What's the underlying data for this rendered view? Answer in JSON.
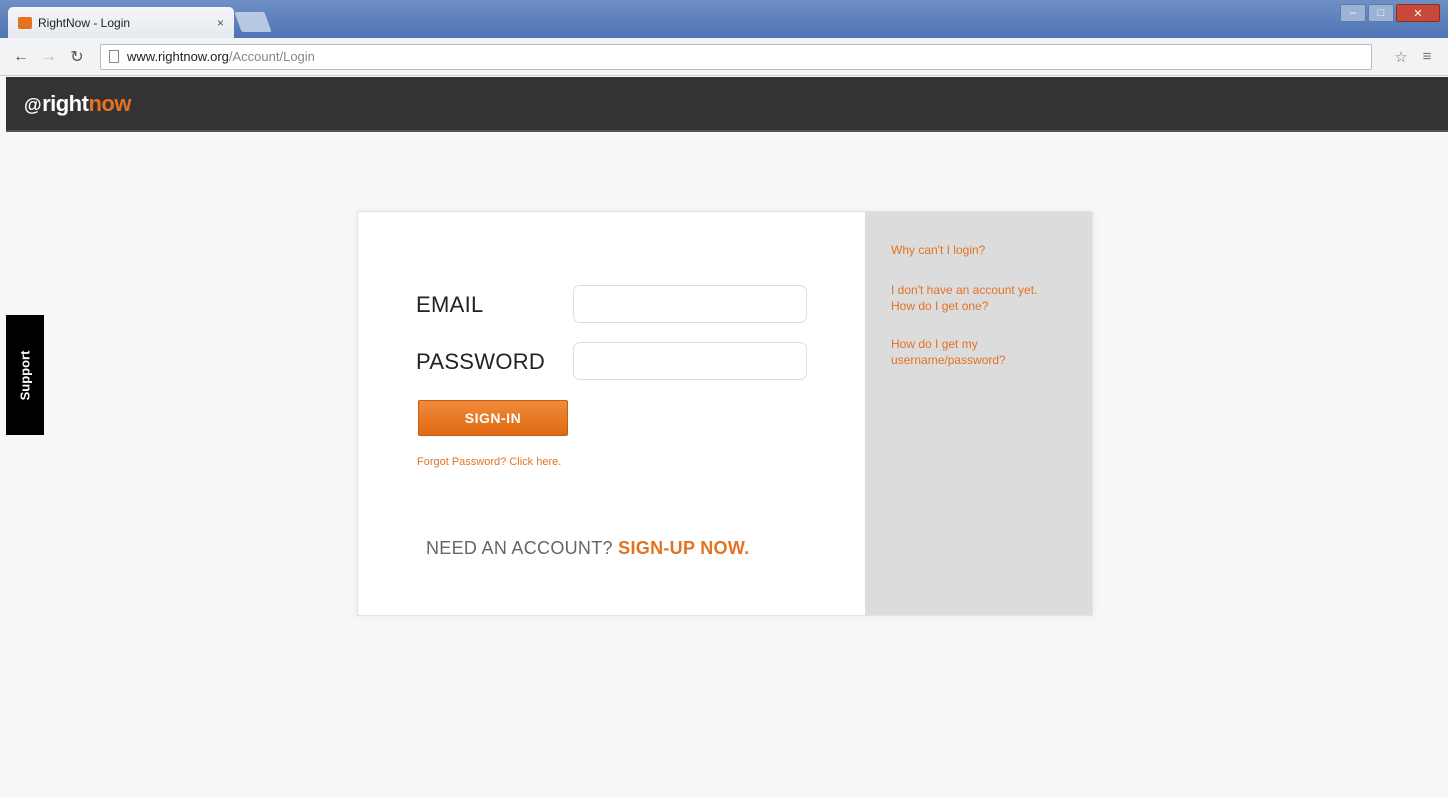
{
  "browser": {
    "tab_title": "RightNow - Login",
    "tab_close": "×",
    "url_host": "www.rightnow.org",
    "url_path": "/Account/Login"
  },
  "site": {
    "logo_prefix": "@",
    "logo_right": "right",
    "logo_now": "now"
  },
  "support": {
    "label": "Support"
  },
  "login": {
    "email_label": "EMAIL",
    "email_value": "",
    "password_label": "PASSWORD",
    "password_value": "",
    "signin_label": "SIGN-IN",
    "forgot_text": "Forgot Password? Click here.",
    "need_account_text": "NEED AN ACCOUNT?",
    "signup_link": "SIGN-UP NOW."
  },
  "help": {
    "links": [
      "Why can't I login?",
      "I don't have an account yet. How do I get one?",
      "How do I get my username/password?"
    ]
  },
  "colors": {
    "accent": "#e37222",
    "header_bg": "#333333",
    "sidebar_bg": "#dcdcdc"
  }
}
